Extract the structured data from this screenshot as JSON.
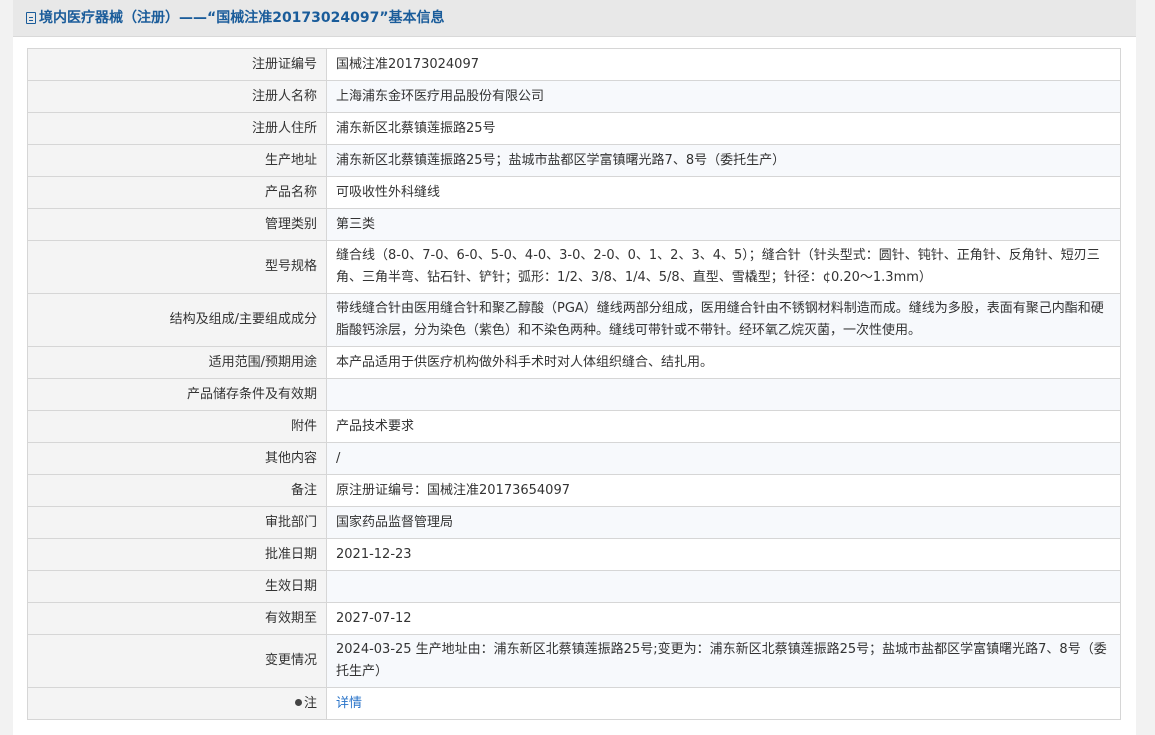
{
  "header": {
    "title": "境内医疗器械（注册）——“国械注准20173024097”基本信息",
    "icon": "document-icon"
  },
  "rows": [
    {
      "label": "注册证编号",
      "value": "国械注准20173024097"
    },
    {
      "label": "注册人名称",
      "value": "上海浦东金环医疗用品股份有限公司"
    },
    {
      "label": "注册人住所",
      "value": "浦东新区北蔡镇莲振路25号"
    },
    {
      "label": "生产地址",
      "value": "浦东新区北蔡镇莲振路25号；盐城市盐都区学富镇曙光路7、8号（委托生产）"
    },
    {
      "label": "产品名称",
      "value": "可吸收性外科缝线"
    },
    {
      "label": "管理类别",
      "value": "第三类"
    },
    {
      "label": "型号规格",
      "value": "缝合线（8-0、7-0、6-0、5-0、4-0、3-0、2-0、0、1、2、3、4、5）；缝合针（针头型式：圆针、钝针、正角针、反角针、短刃三角、三角半弯、钻石针、铲针；弧形：1/2、3/8、1/4、5/8、直型、雪橇型；针径：¢0.20～1.3mm）"
    },
    {
      "label": "结构及组成/主要组成成分",
      "value": "带线缝合针由医用缝合针和聚乙醇酸（PGA）缝线两部分组成，医用缝合针由不锈钢材料制造而成。缝线为多股，表面有聚己内酯和硬脂酸钙涂层，分为染色（紫色）和不染色两种。缝线可带针或不带针。经环氧乙烷灭菌，一次性使用。"
    },
    {
      "label": "适用范围/预期用途",
      "value": "本产品适用于供医疗机构做外科手术时对人体组织缝合、结扎用。"
    },
    {
      "label": "产品储存条件及有效期",
      "value": ""
    },
    {
      "label": "附件",
      "value": "产品技术要求"
    },
    {
      "label": "其他内容",
      "value": "/"
    },
    {
      "label": "备注",
      "value": "原注册证编号：国械注准20173654097"
    },
    {
      "label": "审批部门",
      "value": "国家药品监督管理局"
    },
    {
      "label": "批准日期",
      "value": "2021-12-23"
    },
    {
      "label": "生效日期",
      "value": ""
    },
    {
      "label": "有效期至",
      "value": "2027-07-12"
    },
    {
      "label": "变更情况",
      "value": "2024-03-25 生产地址由：浦东新区北蔡镇莲振路25号;变更为：浦东新区北蔡镇莲振路25号；盐城市盐都区学富镇曙光路7、8号（委托生产）"
    }
  ],
  "note_row": {
    "label": "注",
    "icon": "pin-icon",
    "link": "详情"
  }
}
